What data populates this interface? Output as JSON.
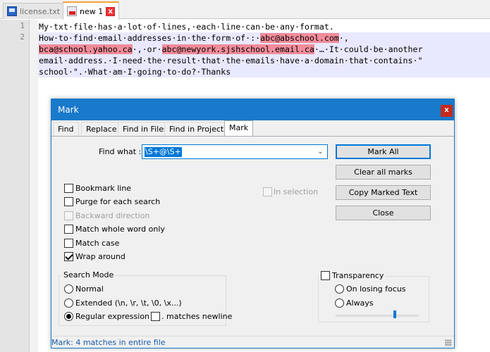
{
  "tabs": [
    {
      "label": "license.txt",
      "icon": "file-saved-icon",
      "active": false
    },
    {
      "label": "new 1",
      "icon": "file-unsaved-icon",
      "active": true
    }
  ],
  "editor": {
    "line_numbers": [
      "1",
      "2"
    ],
    "line1": "My·txt·file·has·a·lot·of·lines,·each·line·can·be·any·format.",
    "line2": {
      "r1_a": "How·to·find·email·addresses·in·the·form·of·:·",
      "r1_email": "abc@abschool.com",
      "r1_b": "·,",
      "r2_email": "bca@school.yahoo.ca",
      "r2_a": "·,·or·",
      "r2_email2": "abc@newyork.sjshschool.email.ca",
      "r2_b": "·…·It·could·be·another",
      "r3": "email·address.·I·need·the·result·that·the·emails·have·a·domain·that·contains·\"",
      "r4": "school·\".·What·am·I·going·to·do?·Thanks"
    },
    "highlight_color": "#f28c9a"
  },
  "dialog": {
    "title": "Mark",
    "close_glyph": "x",
    "tabs": [
      "Find",
      "Replace",
      "Find in Files",
      "Find in Projects",
      "Mark"
    ],
    "active_tab": "Mark",
    "find_what_label": "Find what :",
    "find_what_value": "\\S+@\\S+",
    "buttons": {
      "mark_all": "Mark All",
      "clear_all_marks": "Clear all marks",
      "copy_marked_text": "Copy Marked Text",
      "close": "Close"
    },
    "in_selection": "In selection",
    "options": {
      "bookmark_line": "Bookmark line",
      "purge": "Purge for each search",
      "backward": "Backward direction",
      "whole_word": "Match whole word only",
      "match_case": "Match case",
      "wrap_around": "Wrap around"
    },
    "search_mode": {
      "title": "Search Mode",
      "normal": "Normal",
      "extended": "Extended (\\n, \\r, \\t, \\0, \\x...)",
      "regex": "Regular expression",
      "matches_newline": ". matches newline",
      "selected": "Regular expression"
    },
    "transparency": {
      "title": "Transparency",
      "on_losing_focus": "On losing focus",
      "always": "Always",
      "level": 0.72
    },
    "status": "Mark: 4 matches in entire file",
    "accent_color": "#1979ca"
  }
}
